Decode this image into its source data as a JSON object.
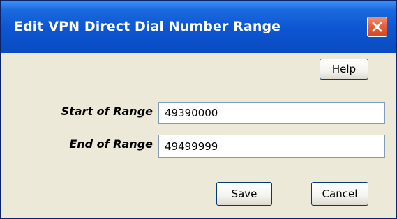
{
  "window": {
    "title": "Edit VPN Direct Dial Number Range",
    "close_icon": "close-icon"
  },
  "toolbar": {
    "help_label": "Help"
  },
  "form": {
    "start_label": "Start of Range",
    "start_value": "49390000",
    "end_label": "End of Range",
    "end_value": "49499999"
  },
  "actions": {
    "save_label": "Save",
    "cancel_label": "Cancel"
  },
  "colors": {
    "titlebar": "#0c55d2",
    "dialog_background": "#ece9d8",
    "close_button": "#e5603c"
  }
}
